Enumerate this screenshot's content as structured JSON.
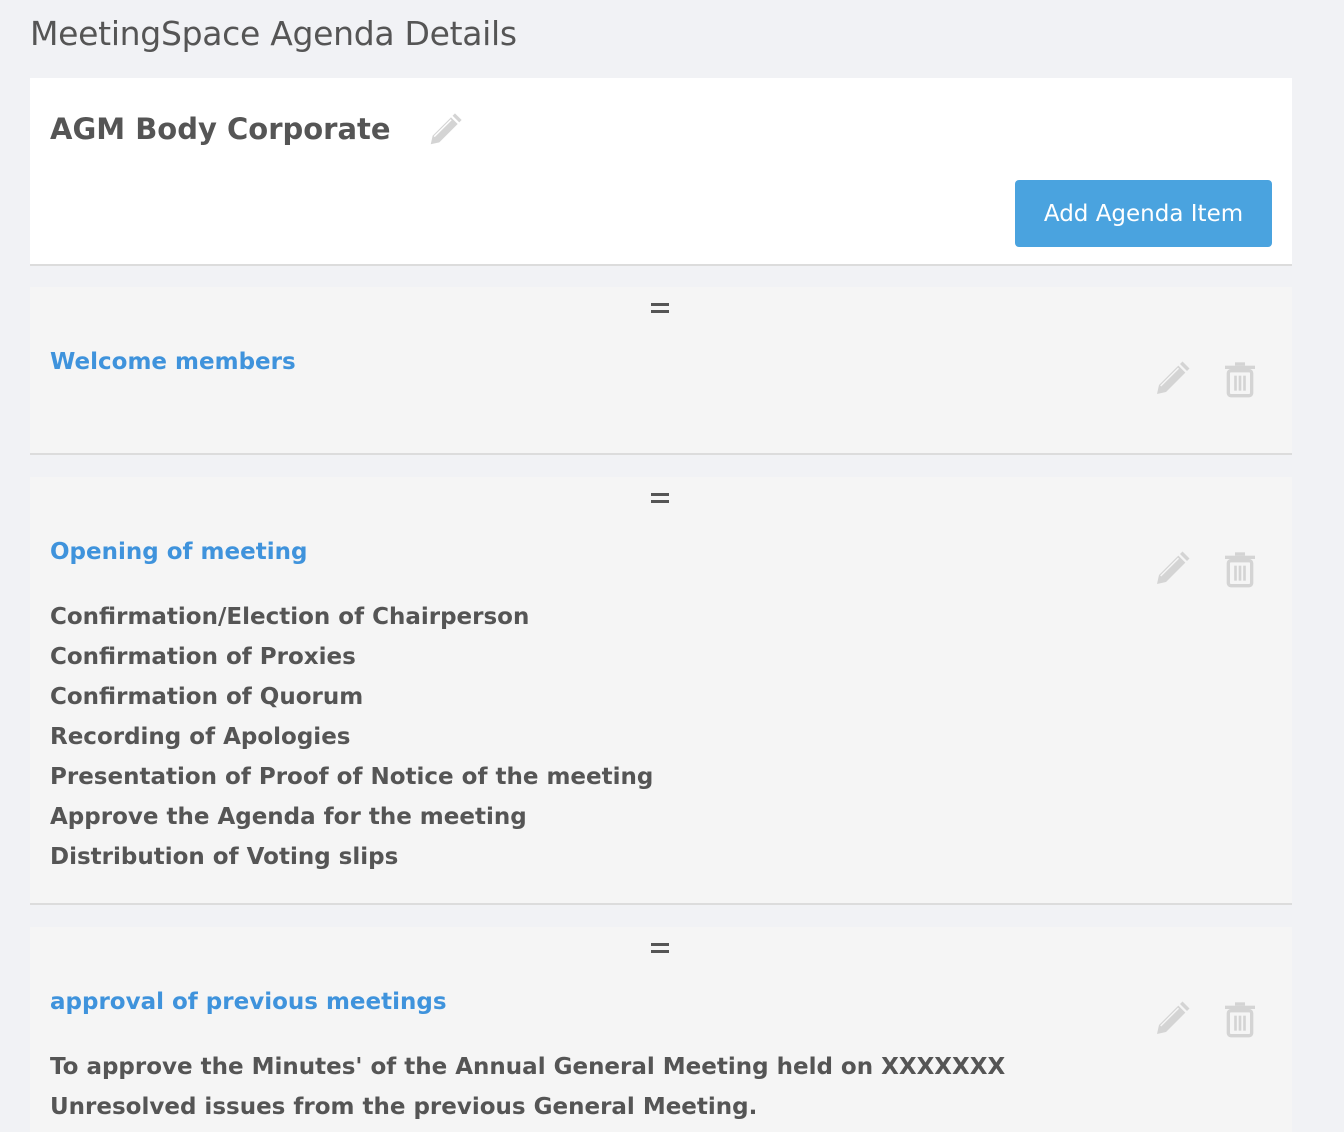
{
  "page": {
    "title": "MeetingSpace Agenda Details"
  },
  "meeting": {
    "name": "AGM Body Corporate",
    "edit_icon": "pencil-icon",
    "add_button_label": "Add Agenda Item"
  },
  "colors": {
    "accent": "#4aa3df",
    "item_title": "#3f93dc",
    "text": "#555555",
    "icon_muted": "#d4d4d4"
  },
  "agenda_items": [
    {
      "title": "Welcome members",
      "lines": [],
      "icons": [
        "drag-handle-icon",
        "pencil-icon",
        "trash-icon"
      ]
    },
    {
      "title": "Opening of meeting",
      "lines": [
        "Confirmation/Election of Chairperson",
        "Confirmation of Proxies",
        "Confirmation of Quorum",
        "Recording of Apologies",
        "Presentation of Proof of Notice of the meeting",
        "Approve the Agenda for the meeting",
        "Distribution of Voting slips"
      ],
      "icons": [
        "drag-handle-icon",
        "pencil-icon",
        "trash-icon"
      ]
    },
    {
      "title": "approval of previous meetings",
      "lines": [
        "To approve the Minutes' of the Annual General Meeting held on XXXXXXX",
        "Unresolved issues from the previous General Meeting."
      ],
      "icons": [
        "drag-handle-icon",
        "pencil-icon",
        "trash-icon"
      ]
    }
  ]
}
